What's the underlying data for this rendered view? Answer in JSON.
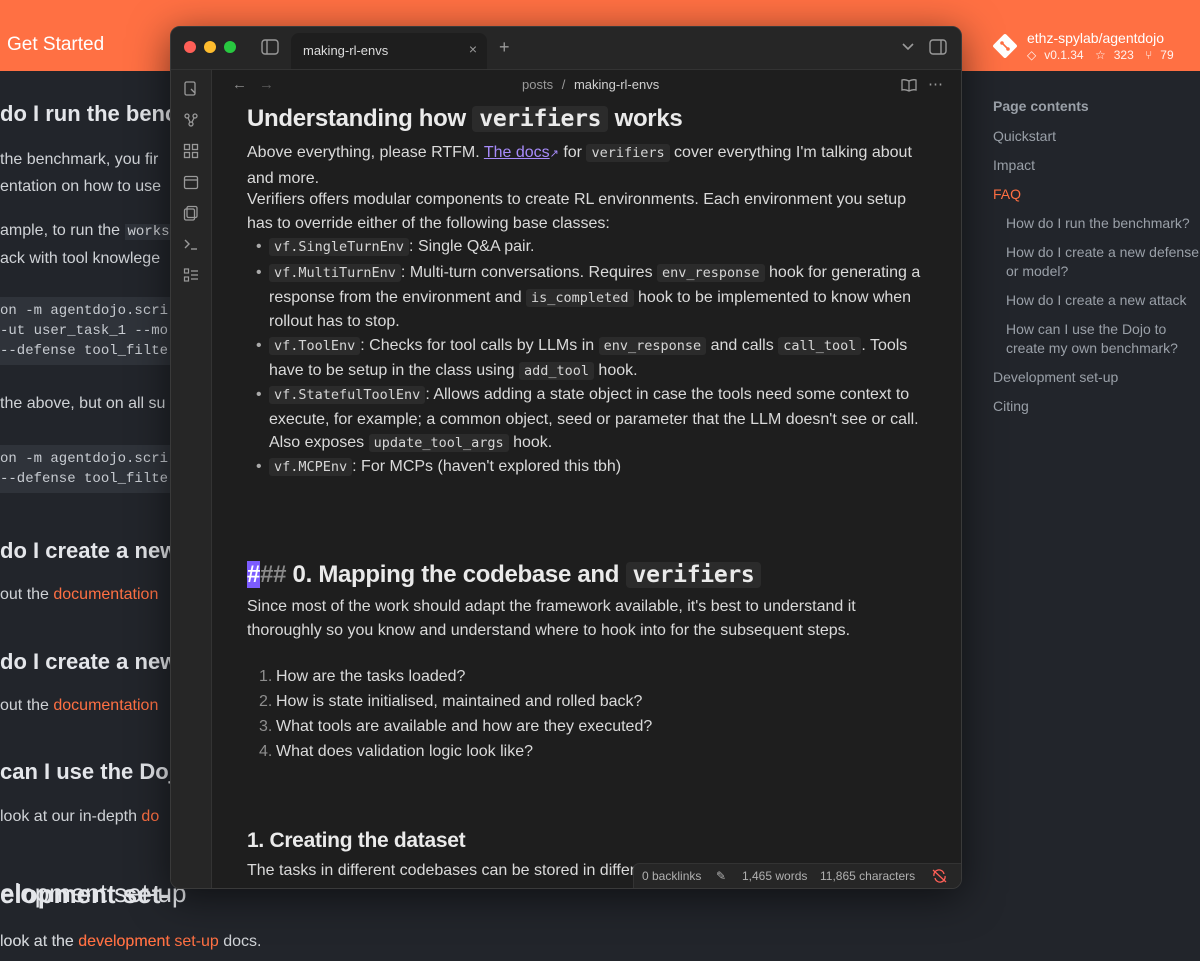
{
  "site": {
    "brand": "Get Started",
    "repo": {
      "name": "ethz-spylab/agentdojo",
      "version": "v0.1.34",
      "stars": "323",
      "forks": "79"
    },
    "doc_fragments": {
      "h_run": "do I run the benchm",
      "p_run_1": "the benchmark, you fir",
      "p_run_2": "entation on how to use",
      "p_example_a": "ample, to run the ",
      "p_example_code": "works",
      "p_example_b": "ack with tool knowlege",
      "code1": [
        "on -m agentdojo.scri",
        "-ut user_task_1 --mo",
        "--defense tool_filte"
      ],
      "p_above": "the above, but on all su",
      "code2": [
        "on -m agentdojo.scri",
        "--defense tool_filte"
      ],
      "h_defense": "do I create a new d",
      "p_defense_pre": "out the ",
      "link_doc1": "documentation",
      "h_attack": "do I create a new a",
      "p_attack_pre": "out the ",
      "link_doc2": "documentation",
      "h_dojo": "can I use the Dojo f",
      "p_dojo_pre": "look at our in-depth ",
      "link_dojo": "do",
      "h_dev": "elopment set-up",
      "p_dev_pre": "look at the ",
      "link_dev": "development set-up",
      "p_dev_post": " docs."
    },
    "toc": {
      "title": "Page contents",
      "items": [
        {
          "label": "Quickstart"
        },
        {
          "label": "Impact"
        },
        {
          "label": "FAQ"
        },
        {
          "label": "How do I run the benchmark?"
        },
        {
          "label": "How do I create a new defense"
        },
        {
          "label": "or model?"
        },
        {
          "label": "How do I create a new attack"
        },
        {
          "label": "How can I use the Dojo to"
        },
        {
          "label": "create my own benchmark?"
        },
        {
          "label": "Development set-up"
        },
        {
          "label": "Citing"
        }
      ]
    }
  },
  "obsidian": {
    "tab_title": "making-rl-envs",
    "tab_close": "×",
    "new_tab": "+",
    "breadcrumb": {
      "folder": "posts",
      "sep": "/",
      "file": "making-rl-envs"
    },
    "note": {
      "h1_pre": "Understanding how ",
      "h1_code": "verifiers",
      "h1_post": " works",
      "p1_pre": "Above everything, please RTFM. ",
      "p1_link": "The docs",
      "p1_mid": " for ",
      "p1_code": "verifiers",
      "p1_post": " cover everything I'm talking about and more.",
      "p2": "Verifiers offers modular components to create RL environments. Each environment you setup has to override either of the following base classes:",
      "b1_code": "vf.SingleTurnEnv",
      "b1_text": ": Single Q&A pair.",
      "b2_code": "vf.MultiTurnEnv",
      "b2_t1": ": Multi-turn conversations. Requires ",
      "b2_code2": "env_response",
      "b2_t2": " hook for generating a response from the environment and ",
      "b2_code3": "is_completed",
      "b2_t3": " hook to be implemented to know when rollout has to stop.",
      "b3_code": "vf.ToolEnv",
      "b3_t1": ": Checks for tool calls by LLMs in ",
      "b3_code2": "env_response",
      "b3_t2": " and calls ",
      "b3_code3": "call_tool",
      "b3_t3": ". Tools have to be setup in the class using ",
      "b3_code4": "add_tool",
      "b3_t4": " hook.",
      "b4_code": "vf.StatefulToolEnv",
      "b4_t1": ": Allows adding a state object in case the tools need some context to execute, for example; a common object, seed or parameter that the LLM doesn't see or call. Also exposes ",
      "b4_code2": "update_tool_args",
      "b4_t2": " hook.",
      "b5_code": "vf.MCPEnv",
      "b5_text": ": For MCPs (haven't explored this tbh)",
      "h2_hash_cursor": "#",
      "h2_hash_rest": "## ",
      "h2_pre": "0. Mapping the codebase and ",
      "h2_code": "verifiers",
      "p3": "Since most of the work should adapt the framework available, it's best to understand it thoroughly so you know and understand where to hook into for the subsequent steps.",
      "ol": [
        {
          "n": "1.",
          "text": "How are the tasks loaded?"
        },
        {
          "n": "2.",
          "text": "How is state initialised, maintained and rolled back?"
        },
        {
          "n": "3.",
          "text": "What tools are available and how are they executed?"
        },
        {
          "n": "4.",
          "text": "What does validation logic look like?"
        }
      ],
      "h3": "1. Creating the dataset",
      "p4": "The tasks in different codebases can be stored in differ"
    },
    "status": {
      "backlinks": "0 backlinks",
      "words": "1,465 words",
      "chars": "11,865 characters"
    }
  },
  "colors": {
    "accent_orange": "#ff7043",
    "obsidian_link": "#a78bfa",
    "cursor": "#7c5cff"
  }
}
